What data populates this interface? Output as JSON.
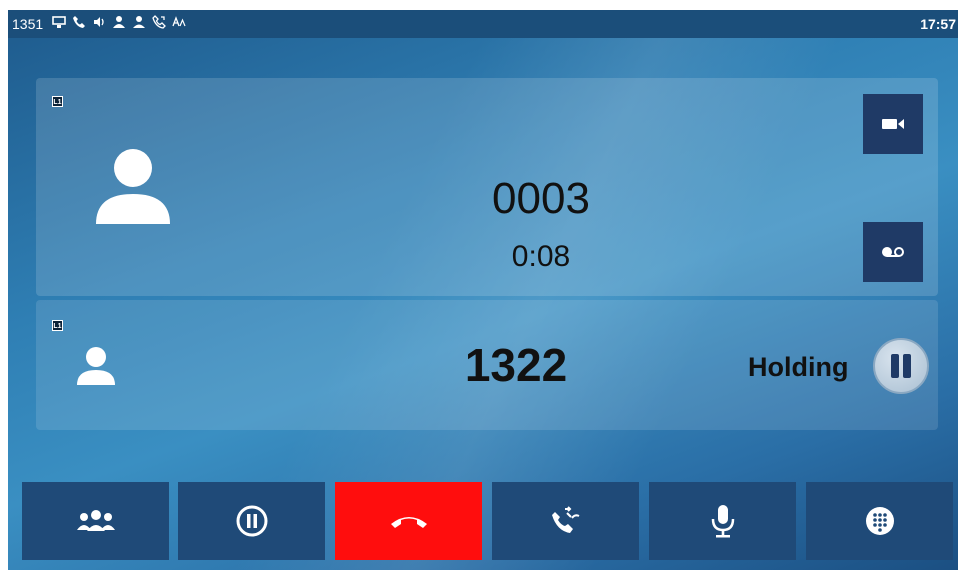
{
  "status_bar": {
    "account": "1351",
    "time": "17:57",
    "icons": [
      "computer-icon",
      "handset-icon",
      "speaker-icon",
      "contacts-icon",
      "user-icon",
      "phone-forward-icon",
      "font-icon"
    ]
  },
  "calls": [
    {
      "line": "L1",
      "number": "0003",
      "duration": "0:08",
      "state": "active",
      "side_buttons": [
        "video-icon",
        "voicemail-record-icon"
      ]
    },
    {
      "line": "L1",
      "number": "1322",
      "status": "Holding",
      "state": "held"
    }
  ],
  "softkeys": [
    {
      "name": "conference",
      "icon": "conference-icon"
    },
    {
      "name": "hold",
      "icon": "pause-circle-icon"
    },
    {
      "name": "end-call",
      "icon": "hang-up-icon",
      "color": "#ff0d0d"
    },
    {
      "name": "transfer",
      "icon": "transfer-icon"
    },
    {
      "name": "mute",
      "icon": "microphone-icon"
    },
    {
      "name": "dialpad",
      "icon": "dialpad-icon"
    }
  ],
  "colors": {
    "status_bar": "#1b4e7a",
    "button": "#1f4a78",
    "end_call": "#ff0d0d",
    "side_button": "#1f3a66"
  }
}
